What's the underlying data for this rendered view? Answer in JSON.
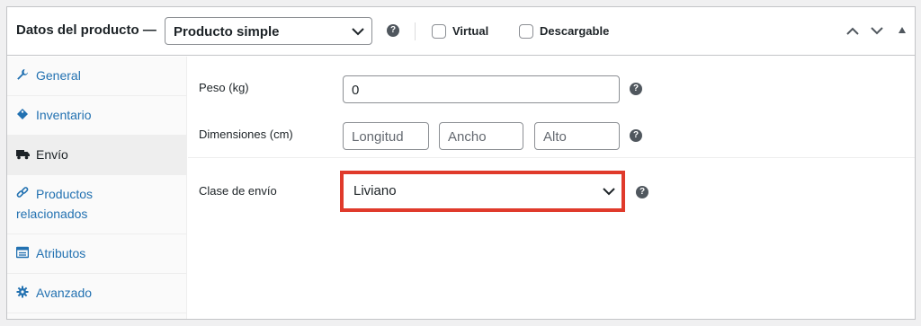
{
  "header": {
    "title": "Datos del producto —",
    "product_type": "Producto simple",
    "virtual_label": "Virtual",
    "downloadable_label": "Descargable",
    "virtual_checked": false,
    "downloadable_checked": false
  },
  "sidebar": {
    "items": [
      {
        "label": "General",
        "icon": "wrench-icon",
        "active": false
      },
      {
        "label": "Inventario",
        "icon": "tag-icon",
        "active": false
      },
      {
        "label": "Envío",
        "icon": "truck-icon",
        "active": true
      },
      {
        "label": "Productos relacionados",
        "icon": "link-icon",
        "active": false
      },
      {
        "label": "Atributos",
        "icon": "list-icon",
        "active": false
      },
      {
        "label": "Avanzado",
        "icon": "gear-icon",
        "active": false
      }
    ]
  },
  "shipping": {
    "weight_label": "Peso (kg)",
    "weight_value": "0",
    "dimensions_label": "Dimensiones (cm)",
    "length_placeholder": "Longitud",
    "width_placeholder": "Ancho",
    "height_placeholder": "Alto",
    "class_label": "Clase de envío",
    "class_value": "Liviano"
  },
  "colors": {
    "link": "#2271b1",
    "highlight": "#e03a2b",
    "active_tab_bg": "#eeeeee"
  }
}
